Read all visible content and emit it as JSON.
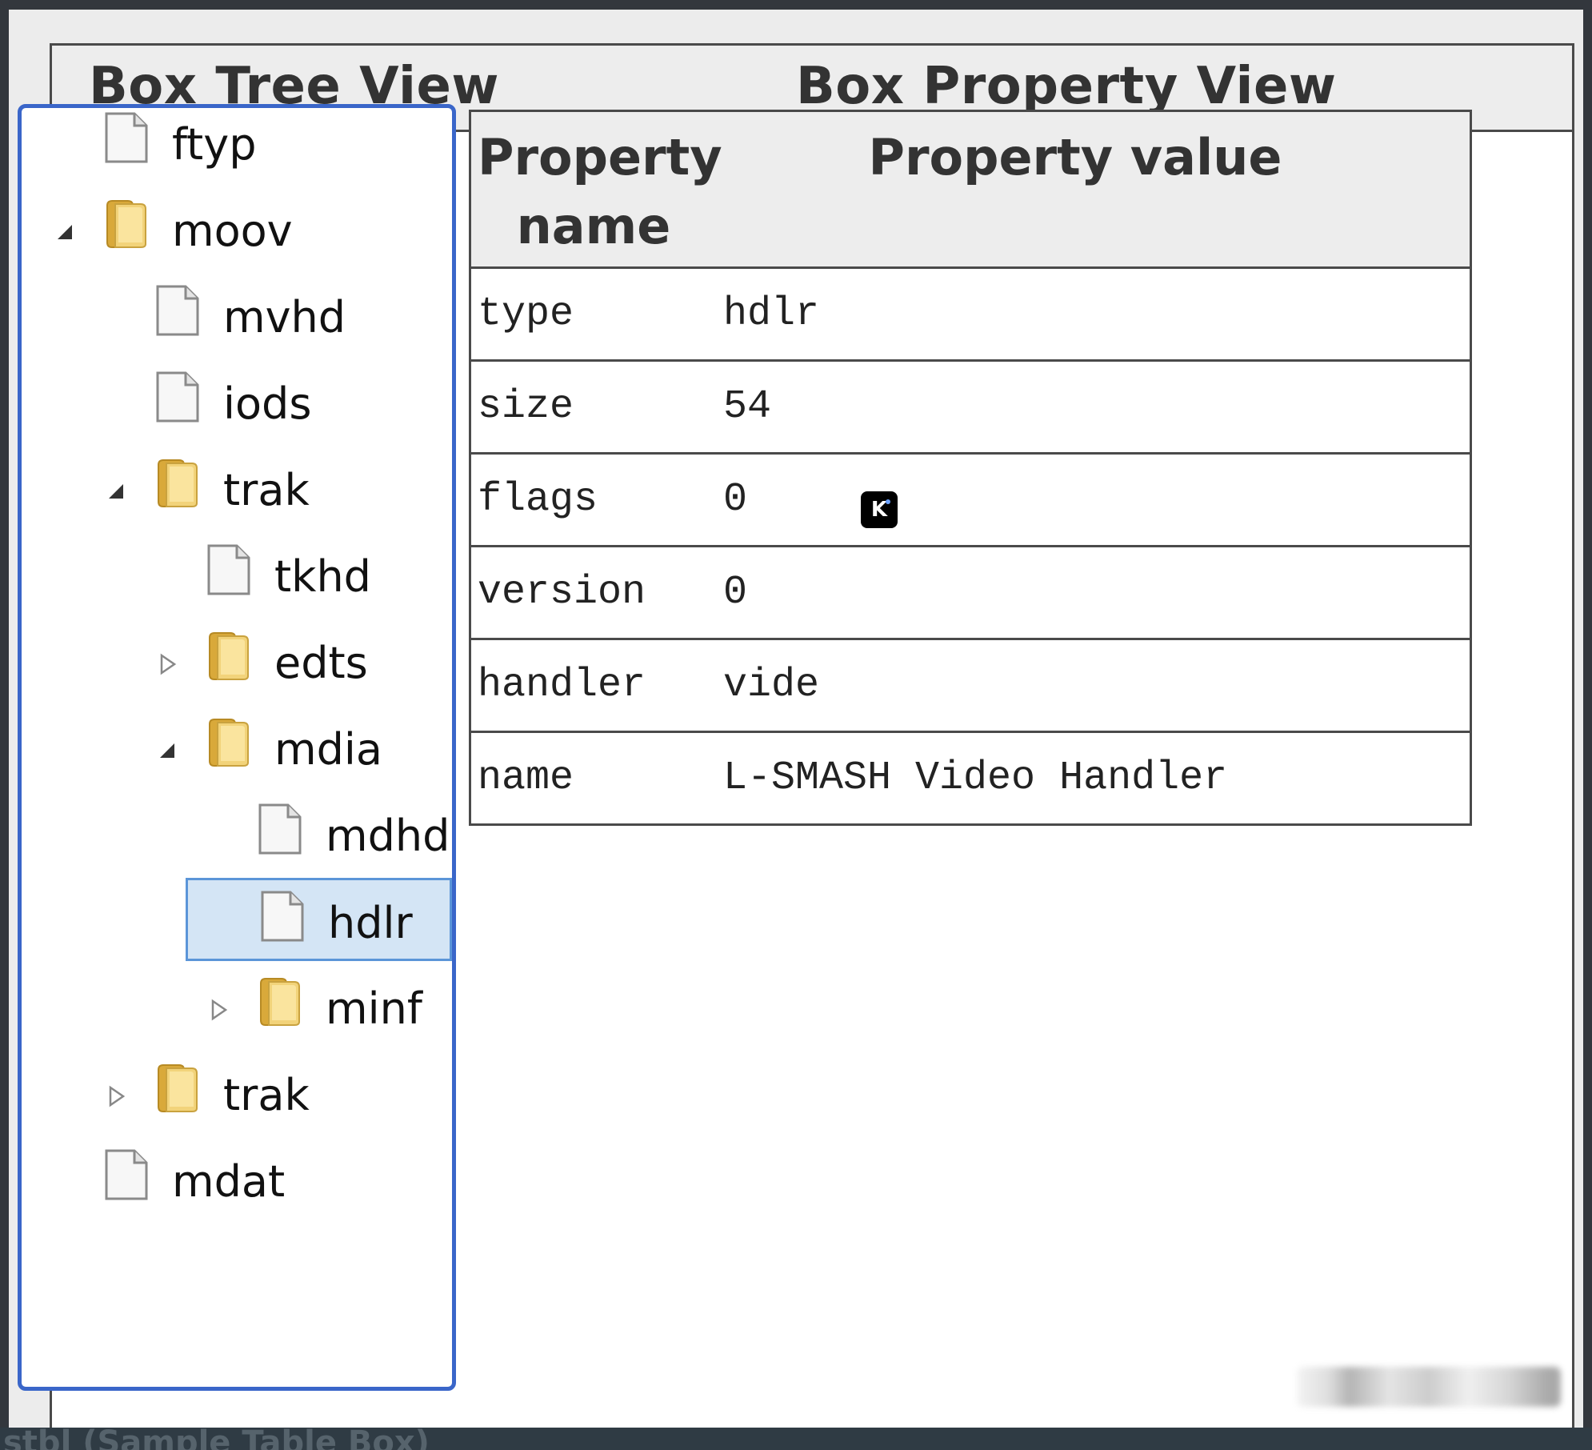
{
  "headers": {
    "tree_title": "Box Tree View",
    "property_title": "Box Property View"
  },
  "tree": {
    "items": [
      {
        "label": "ftyp",
        "type": "file",
        "toggle": "none"
      },
      {
        "label": "moov",
        "type": "folder",
        "toggle": "expanded"
      },
      {
        "label": "mvhd",
        "type": "file",
        "toggle": "none"
      },
      {
        "label": "iods",
        "type": "file",
        "toggle": "none"
      },
      {
        "label": "trak",
        "type": "folder",
        "toggle": "expanded"
      },
      {
        "label": "tkhd",
        "type": "file",
        "toggle": "none"
      },
      {
        "label": "edts",
        "type": "folder",
        "toggle": "collapsed"
      },
      {
        "label": "mdia",
        "type": "folder",
        "toggle": "expanded"
      },
      {
        "label": "mdhd",
        "type": "file",
        "toggle": "none"
      },
      {
        "label": "hdlr",
        "type": "file",
        "toggle": "none",
        "selected": true
      },
      {
        "label": "minf",
        "type": "folder",
        "toggle": "collapsed"
      },
      {
        "label": "trak",
        "type": "folder",
        "toggle": "collapsed"
      },
      {
        "label": "mdat",
        "type": "file",
        "toggle": "none"
      }
    ]
  },
  "properties": {
    "col_name_line1": "Property",
    "col_name_line2": "name",
    "col_value": "Property value",
    "rows": [
      {
        "name": "type",
        "value": "hdlr"
      },
      {
        "name": "size",
        "value": "54"
      },
      {
        "name": "flags",
        "value": "0"
      },
      {
        "name": "version",
        "value": "0"
      },
      {
        "name": "handler",
        "value": "vide"
      },
      {
        "name": "name",
        "value": "L-SMASH Video Handler"
      }
    ]
  },
  "badge": {
    "text": "K"
  },
  "footer_text": "stbl (Sample Table Box)",
  "colors": {
    "selection": "#d4e5f5",
    "selection_border": "#5b95d8",
    "tree_border": "#3a66c9",
    "folder": "#e8c45a"
  },
  "icons": {
    "file": "file-icon",
    "folder": "folder-icon",
    "expanded": "triangle-expanded-icon",
    "collapsed": "triangle-collapsed-icon"
  }
}
